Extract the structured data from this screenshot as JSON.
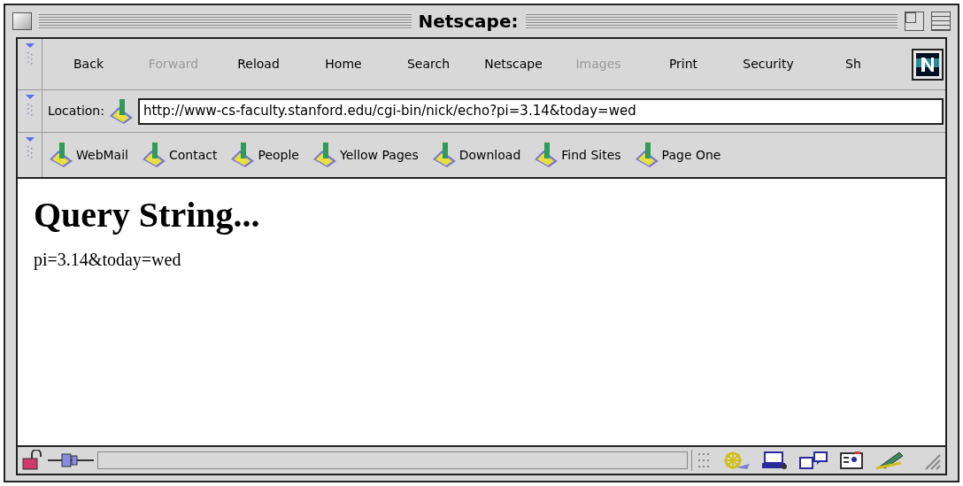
{
  "window": {
    "title": "Netscape:"
  },
  "nav_toolbar": {
    "buttons": [
      {
        "label": "Back",
        "disabled": false
      },
      {
        "label": "Forward",
        "disabled": true
      },
      {
        "label": "Reload",
        "disabled": false
      },
      {
        "label": "Home",
        "disabled": false
      },
      {
        "label": "Search",
        "disabled": false
      },
      {
        "label": "Netscape",
        "disabled": false
      },
      {
        "label": "Images",
        "disabled": true
      },
      {
        "label": "Print",
        "disabled": false
      },
      {
        "label": "Security",
        "disabled": false
      },
      {
        "label": "Sh",
        "disabled": false
      }
    ]
  },
  "location": {
    "label": "Location:",
    "value": "http://www-cs-faculty.stanford.edu/cgi-bin/nick/echo?pi=3.14&today=wed"
  },
  "personal_toolbar": {
    "items": [
      "WebMail",
      "Contact",
      "People",
      "Yellow Pages",
      "Download",
      "Find Sites",
      "Page One"
    ]
  },
  "content": {
    "heading": "Query String...",
    "body": "pi=3.14&today=wed"
  }
}
